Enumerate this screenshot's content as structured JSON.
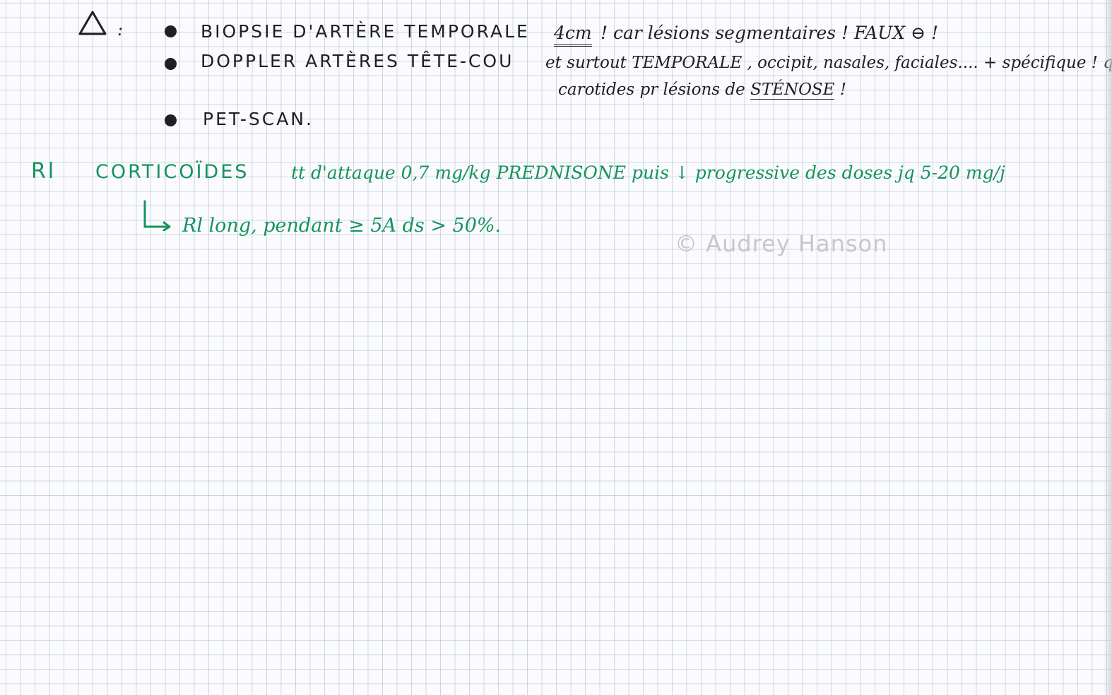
{
  "page": {
    "ink_colors": {
      "black": "#1f1f24",
      "green": "#14935f"
    }
  },
  "warning": {
    "icon": "triangle-icon",
    "separator": ":"
  },
  "exams": [
    {
      "label": "BIOPSIE D'ARTÈRE TEMPORALE"
    },
    {
      "label": "DOPPLER ARTÈRES TÊTE-COU"
    },
    {
      "label": "PET-SCAN."
    }
  ],
  "biopsy_note": {
    "length": "4cm",
    "rest": "! car lésions segmentaires ! FAUX ⊖ !"
  },
  "doppler_note": {
    "line1": "et surtout TEMPORALE , occipit, nasales, faciales.... + spécifique ! q",
    "line2_before": "carotides pr lésions de ",
    "line2_stenose": "STÉNOSE",
    "line2_after": " !"
  },
  "treatment": {
    "tag": "Rl",
    "drug_class": "CORTICOÏDES",
    "detail": "tt d'attaque 0,7 mg/kg PREDNISONE puis ↓ progressive des doses jq 5-20 mg/j",
    "followup_arrow": "↳",
    "followup": "Rl long, pendant ≥ 5A ds > 50%."
  },
  "watermark": "© Audrey Hanson"
}
